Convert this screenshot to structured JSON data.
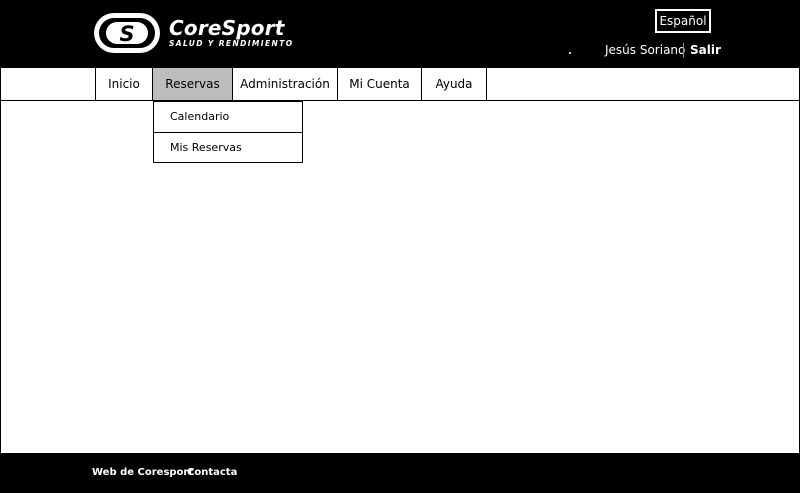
{
  "header": {
    "logo": {
      "name": "CoreSport",
      "tagline": "SALUD Y RENDIMIENTO",
      "mark_letter": "S"
    },
    "language_button": "Español",
    "user_name": "Jesús Soriano",
    "logout_label": "Salir"
  },
  "nav": {
    "items": [
      {
        "label": "Inicio"
      },
      {
        "label": "Reservas"
      },
      {
        "label": "Administración"
      },
      {
        "label": "Mi Cuenta"
      },
      {
        "label": "Ayuda"
      }
    ],
    "active_index": 1
  },
  "dropdown": {
    "items": [
      {
        "label": "Calendario"
      },
      {
        "label": "Mis Reservas"
      }
    ]
  },
  "footer": {
    "links": [
      {
        "label": "Web de Coresport"
      },
      {
        "label": "Contacta"
      }
    ]
  },
  "colors": {
    "header_bg": "#000000",
    "nav_active_bg": "#bdbdbd",
    "text_on_dark": "#ffffff"
  }
}
